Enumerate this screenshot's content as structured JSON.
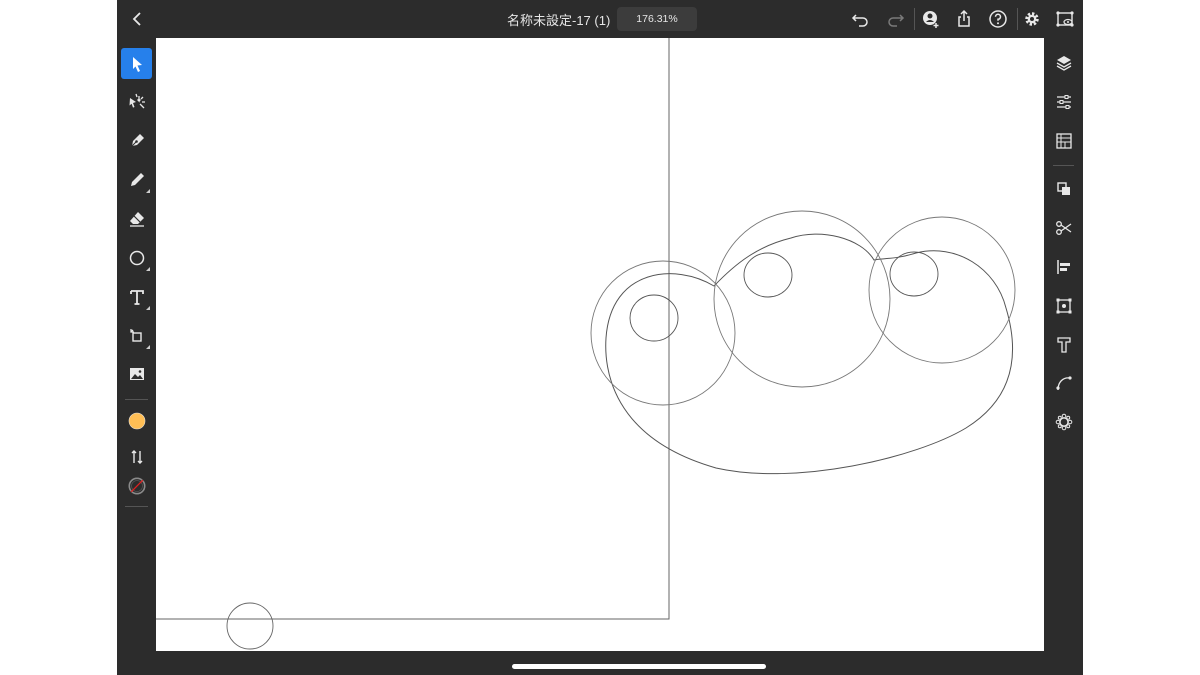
{
  "document": {
    "title": "名称未設定-17 (1)",
    "zoom": "176.31%"
  },
  "topbar": {
    "buttons": [
      "back",
      "undo",
      "redo",
      "invite",
      "share",
      "help",
      "settings",
      "fullscreen-preview"
    ]
  },
  "left_toolbar": {
    "tools": [
      {
        "name": "selection-tool",
        "icon": "arrow-icon",
        "active": true
      },
      {
        "name": "direct-selection-tool",
        "icon": "magic-arrow-icon",
        "active": false
      },
      {
        "name": "pen-tool",
        "icon": "pen-nib-icon",
        "active": false
      },
      {
        "name": "pencil-tool",
        "icon": "pencil-icon",
        "active": false
      },
      {
        "name": "eraser-tool",
        "icon": "eraser-icon",
        "active": false
      },
      {
        "name": "shape-tool",
        "icon": "ellipse-icon",
        "active": false
      },
      {
        "name": "type-tool",
        "icon": "type-icon",
        "active": false
      },
      {
        "name": "transform-tool",
        "icon": "rotate-shape-icon",
        "active": false
      },
      {
        "name": "place-image-tool",
        "icon": "image-icon",
        "active": false
      }
    ],
    "fill_color": "#ffbe55",
    "stroke": "none"
  },
  "right_toolbar": {
    "panels": [
      "layers",
      "properties",
      "libraries",
      "arrange",
      "pathfinder",
      "align",
      "transform",
      "type",
      "path-edit",
      "repeat"
    ]
  },
  "colors": {
    "ui_background": "#2c2c2c",
    "accent": "#2680eb",
    "canvas": "#ffffff",
    "path_stroke": "#555555"
  }
}
